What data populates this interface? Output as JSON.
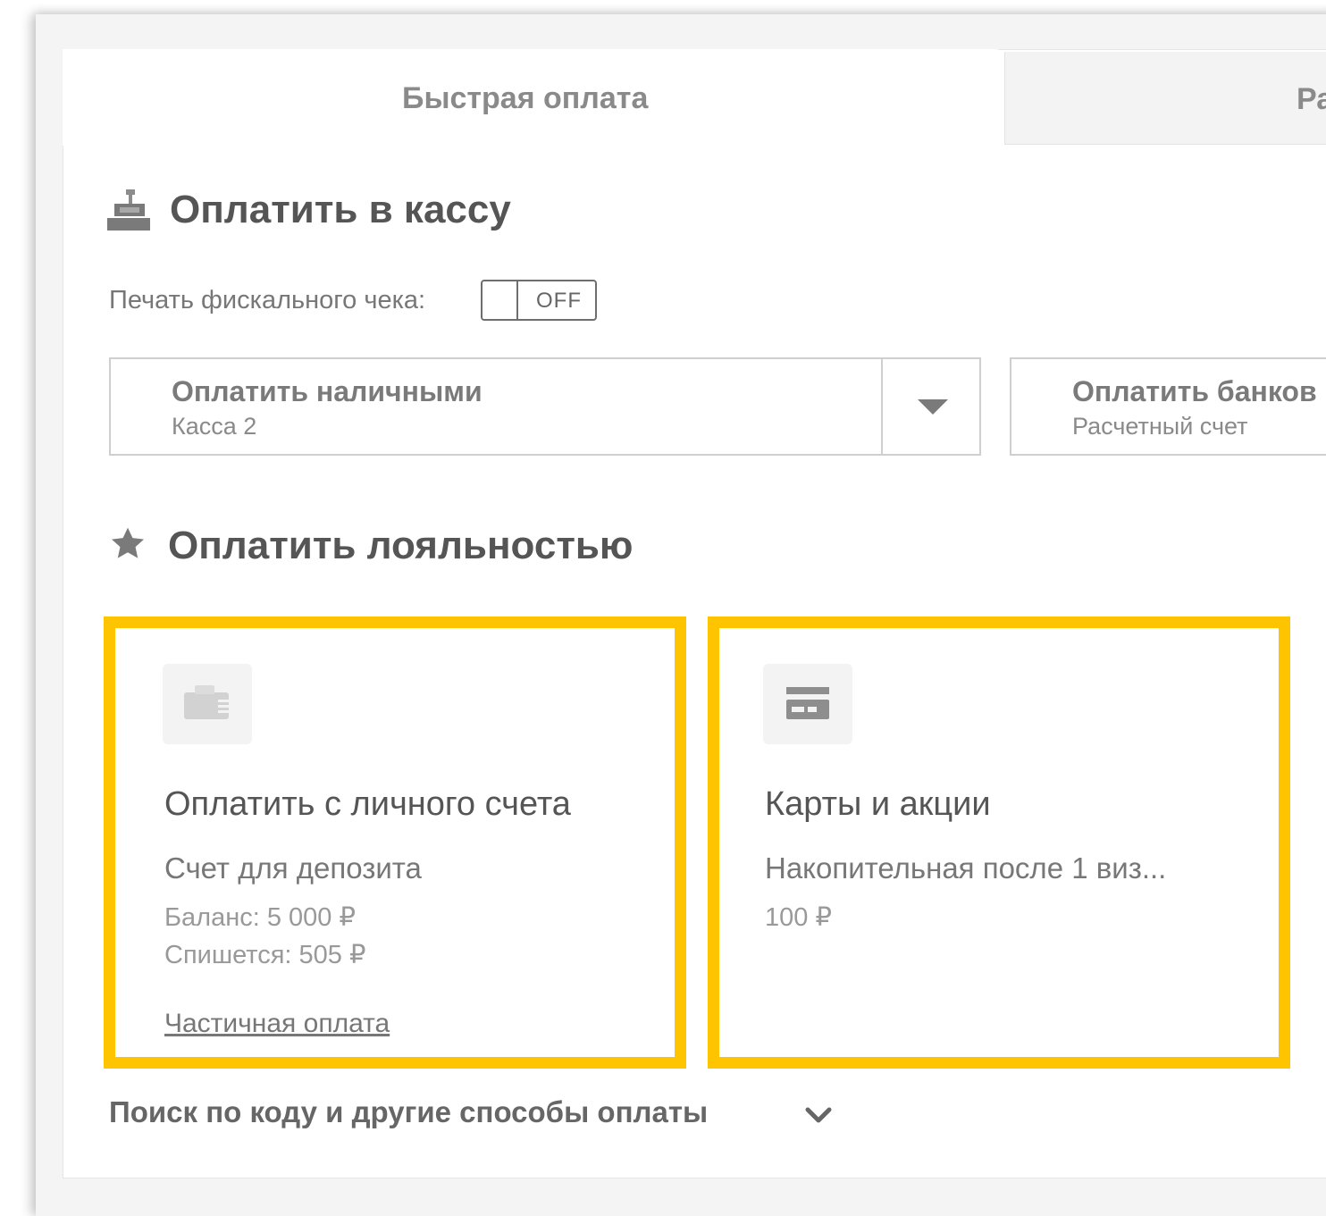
{
  "tabs": [
    {
      "label": "Быстрая оплата",
      "active": true
    },
    {
      "label": "Ра",
      "active": false
    }
  ],
  "cashier": {
    "title": "Оплатить в кассу",
    "icon": "cash-register-icon",
    "fiscal_label": "Печать фискального чека:",
    "fiscal_toggle_state": "OFF",
    "cash_payment": {
      "title": "Оплатить наличными",
      "subtitle": "Касса 2"
    },
    "bank_payment": {
      "title": "Оплатить банков",
      "subtitle": "Расчетный счет"
    }
  },
  "loyalty": {
    "title": "Оплатить лояльностью",
    "icon": "star-icon",
    "highlight_color": "#ffc400",
    "cards": [
      {
        "icon": "wallet-icon",
        "title": "Оплатить с личного счета",
        "subtitle": "Счет для депозита",
        "balance": "Баланс: 5 000 ₽",
        "charge": "Спишется: 505 ₽",
        "link": "Частичная оплата"
      },
      {
        "icon": "credit-card-icon",
        "title": "Карты и акции",
        "subtitle": "Накопительная после 1 виз...",
        "amount": "100 ₽"
      }
    ]
  },
  "footer": {
    "more_label": "Поиск по коду и другие способы оплаты",
    "icon": "chevron-down-icon"
  }
}
